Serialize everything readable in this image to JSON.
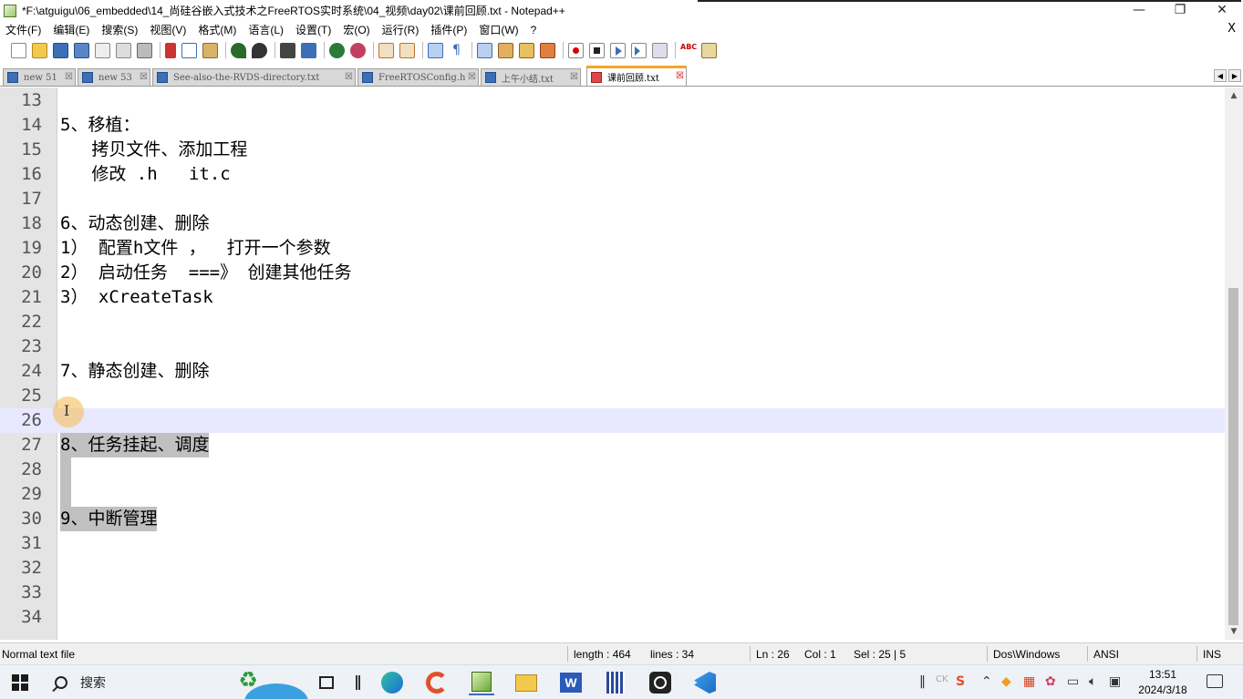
{
  "window": {
    "title": "*F:\\atguigu\\06_embedded\\14_尚硅谷嵌入式技术之FreeRTOS实时系统\\04_视频\\day02\\课前回顾.txt - Notepad++",
    "minimize": "—",
    "restore": "❐",
    "close": "✕"
  },
  "menu": {
    "items": [
      "文件(F)",
      "编辑(E)",
      "搜索(S)",
      "视图(V)",
      "格式(M)",
      "语言(L)",
      "设置(T)",
      "宏(O)",
      "运行(R)",
      "插件(P)",
      "窗口(W)",
      "?"
    ],
    "close_doc": "X"
  },
  "toolbar": {
    "icons": [
      "new-file-icon",
      "open-file-icon",
      "save-icon",
      "save-all-icon",
      "close-icon",
      "close-all-icon",
      "print-icon",
      "cut-icon",
      "copy-icon",
      "paste-icon",
      "undo-icon",
      "redo-icon",
      "find-icon",
      "replace-icon",
      "zoom-in-icon",
      "zoom-out-icon",
      "sync-v-icon",
      "sync-h-icon",
      "word-wrap-icon",
      "show-all-chars-icon",
      "indent-guide-icon",
      "doc-map-icon",
      "function-list-icon",
      "folder-workspace-icon",
      "record-macro-icon",
      "stop-macro-icon",
      "play-macro-icon",
      "run-macro-multiple-icon",
      "save-macro-icon",
      "spellcheck-icon",
      "doc-switcher-icon"
    ]
  },
  "tabs": [
    {
      "label": "new  51",
      "active": false
    },
    {
      "label": "new  53",
      "active": false
    },
    {
      "label": "See-also-the-RVDS-directory.txt",
      "active": false
    },
    {
      "label": "FreeRTOSConfig.h",
      "active": false
    },
    {
      "label": "上午小结.txt",
      "active": false
    },
    {
      "label": "课前回顾.txt",
      "active": true
    }
  ],
  "editor": {
    "lines": [
      {
        "n": "13",
        "t": ""
      },
      {
        "n": "14",
        "t": "5、移植："
      },
      {
        "n": "15",
        "t": "   拷贝文件、添加工程"
      },
      {
        "n": "16",
        "t": "   修改 .h   it.c"
      },
      {
        "n": "17",
        "t": ""
      },
      {
        "n": "18",
        "t": "6、动态创建、删除"
      },
      {
        "n": "19",
        "t": "1） 配置h文件 ，  打开一个参数"
      },
      {
        "n": "20",
        "t": "2） 启动任务  ===》 创建其他任务"
      },
      {
        "n": "21",
        "t": "3） xCreateTask"
      },
      {
        "n": "22",
        "t": ""
      },
      {
        "n": "23",
        "t": ""
      },
      {
        "n": "24",
        "t": "7、静态创建、删除"
      },
      {
        "n": "25",
        "t": ""
      },
      {
        "n": "26",
        "t": ""
      },
      {
        "n": "27",
        "t": "8、任务挂起、调度"
      },
      {
        "n": "28",
        "t": ""
      },
      {
        "n": "29",
        "t": ""
      },
      {
        "n": "30",
        "t": "9、中断管理"
      },
      {
        "n": "31",
        "t": ""
      },
      {
        "n": "32",
        "t": ""
      },
      {
        "n": "33",
        "t": ""
      },
      {
        "n": "34",
        "t": ""
      }
    ],
    "current_line": "26",
    "selected_lines": [
      "27",
      "28",
      "29",
      "30"
    ]
  },
  "status": {
    "file_type": "Normal text file",
    "length": "length : 464",
    "lines": "lines : 34",
    "ln": "Ln : 26",
    "col": "Col : 1",
    "sel": "Sel : 25 | 5",
    "eol": "Dos\\Windows",
    "encoding": "ANSI",
    "mode": "INS"
  },
  "taskbar": {
    "search_label": "搜索",
    "time": "13:51",
    "date": "2024/3/18",
    "tray_text": "CK"
  }
}
